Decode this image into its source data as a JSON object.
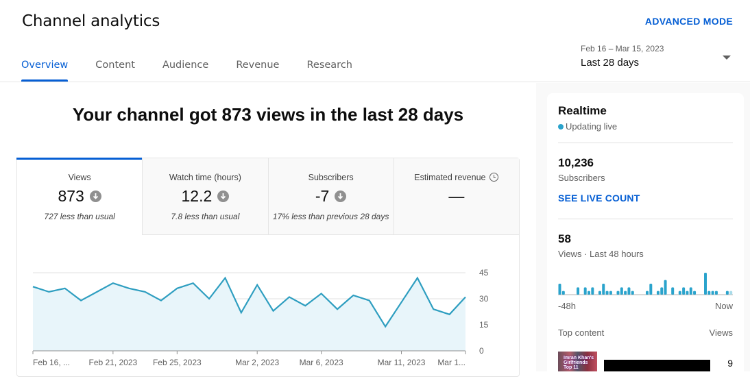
{
  "header": {
    "title": "Channel analytics",
    "advanced_mode": "ADVANCED MODE",
    "tabs": [
      {
        "label": "Overview",
        "active": true
      },
      {
        "label": "Content",
        "active": false
      },
      {
        "label": "Audience",
        "active": false
      },
      {
        "label": "Revenue",
        "active": false
      },
      {
        "label": "Research",
        "active": false
      }
    ],
    "date_range": {
      "dates": "Feb 16 – Mar 15, 2023",
      "label": "Last 28 days"
    }
  },
  "headline": "Your channel got 873 views in the last 28 days",
  "metrics": [
    {
      "label": "Views",
      "value": "873",
      "trend": "down",
      "note": "727 less than usual",
      "active": true
    },
    {
      "label": "Watch time (hours)",
      "value": "12.2",
      "trend": "down",
      "note": "7.8 less than usual",
      "active": false
    },
    {
      "label": "Subscribers",
      "value": "-7",
      "trend": "down",
      "note": "17% less than previous 28 days",
      "active": false
    },
    {
      "label": "Estimated revenue",
      "value": "—",
      "trend": null,
      "note": "",
      "active": false,
      "icon": "clock-icon"
    }
  ],
  "colors": {
    "accent": "#065fd4",
    "line": "#2e9ec0",
    "fill": "#e8f5fa",
    "bars": "#2aa3cc"
  },
  "chart_data": {
    "type": "area",
    "title": "Views",
    "xlabel": "",
    "ylabel": "",
    "ylim": [
      0,
      45
    ],
    "yticks": [
      0,
      15,
      30,
      45
    ],
    "xtick_labels": [
      "Feb 16, ...",
      "Feb 21, 2023",
      "Feb 25, 2023",
      "Mar 2, 2023",
      "Mar 6, 2023",
      "Mar 11, 2023",
      "Mar 1..."
    ],
    "xtick_indices": [
      0,
      5,
      9,
      14,
      18,
      23,
      27
    ],
    "x": [
      "Feb 16",
      "Feb 17",
      "Feb 18",
      "Feb 19",
      "Feb 20",
      "Feb 21",
      "Feb 22",
      "Feb 23",
      "Feb 24",
      "Feb 25",
      "Feb 26",
      "Feb 27",
      "Feb 28",
      "Mar 1",
      "Mar 2",
      "Mar 3",
      "Mar 4",
      "Mar 5",
      "Mar 6",
      "Mar 7",
      "Mar 8",
      "Mar 9",
      "Mar 10",
      "Mar 11",
      "Mar 12",
      "Mar 13",
      "Mar 14",
      "Mar 15"
    ],
    "series": [
      {
        "name": "Views",
        "values": [
          37,
          34,
          36,
          29,
          34,
          39,
          36,
          34,
          29,
          36,
          39,
          30,
          42,
          22,
          38,
          23,
          31,
          26,
          33,
          24,
          32,
          29,
          14,
          28,
          42,
          24,
          21,
          31
        ]
      }
    ],
    "grid": true
  },
  "realtime": {
    "title": "Realtime",
    "status": "Updating live",
    "subscribers_count": "10,236",
    "subscribers_label": "Subscribers",
    "see_live_count": "SEE LIVE COUNT",
    "views_count": "58",
    "views_label": "Views · Last 48 hours",
    "bar_start_label": "-48h",
    "bar_end_label": "Now",
    "hourly_views": [
      3,
      1,
      0,
      0,
      0,
      2,
      0,
      2,
      1,
      2,
      0,
      1,
      3,
      1,
      1,
      0,
      1,
      2,
      1,
      2,
      1,
      0,
      0,
      0,
      1,
      3,
      0,
      1,
      2,
      4,
      0,
      2,
      0,
      1,
      2,
      1,
      2,
      1,
      0,
      0,
      6,
      1,
      1,
      1,
      0,
      0,
      1,
      1
    ],
    "top_content_label": "Top content",
    "top_content_views_label": "Views",
    "top_content": [
      {
        "thumbnail_text": "Imran Khan's Girlfriends Top 11",
        "views": "9"
      }
    ]
  }
}
